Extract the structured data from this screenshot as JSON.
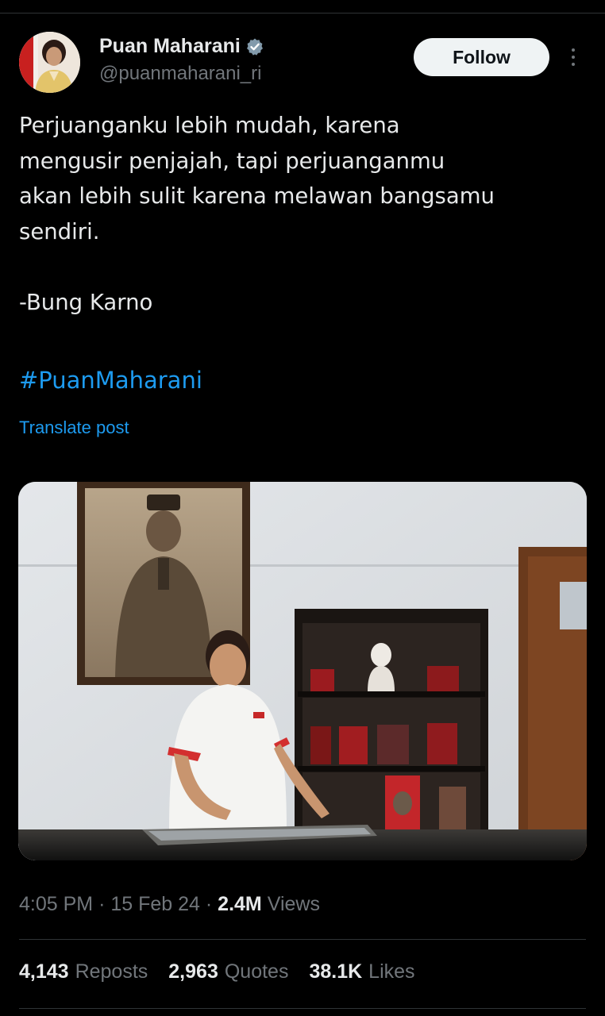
{
  "author": {
    "display_name": "Puan Maharani",
    "handle": "@puanmaharani_ri",
    "verified": true,
    "verified_icon": "verified-badge-icon"
  },
  "actions": {
    "follow_label": "Follow",
    "more_icon": "more-options-icon"
  },
  "post": {
    "lines": [
      "Perjuanganku lebih mudah, karena",
      "mengusir penjajah, tapi perjuanganmu",
      "akan lebih sulit karena melawan bangsamu",
      "sendiri."
    ],
    "attribution": "-Bung Karno",
    "hashtag": "#PuanMaharani",
    "translate_label": "Translate post"
  },
  "meta": {
    "time": "4:05 PM",
    "separator": "·",
    "date": "15 Feb 24",
    "views_count": "2.4M",
    "views_label": "Views"
  },
  "stats": {
    "reposts_count": "4,143",
    "reposts_label": "Reposts",
    "quotes_count": "2,963",
    "quotes_label": "Quotes",
    "likes_count": "38.1K",
    "likes_label": "Likes"
  },
  "colors": {
    "background": "#000000",
    "text": "#e7e9ea",
    "muted": "#71767b",
    "accent": "#1d9bf0",
    "divider": "#2f3336"
  }
}
